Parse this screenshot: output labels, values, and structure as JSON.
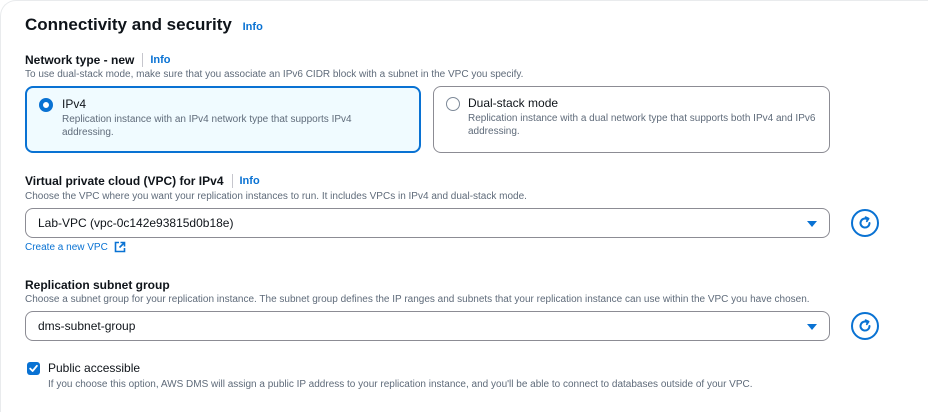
{
  "section": {
    "title": "Connectivity and security",
    "info": "Info"
  },
  "network_type": {
    "label": "Network type - new",
    "info": "Info",
    "description": "To use dual-stack mode, make sure that you associate an IPv6 CIDR block with a subnet in the VPC you specify.",
    "options": [
      {
        "title": "IPv4",
        "description": "Replication instance with an IPv4 network type that supports IPv4 addressing.",
        "selected": true
      },
      {
        "title": "Dual-stack mode",
        "description": "Replication instance with a dual network type that supports both IPv4 and IPv6 addressing.",
        "selected": false
      }
    ]
  },
  "vpc": {
    "label": "Virtual private cloud (VPC) for IPv4",
    "info": "Info",
    "description": "Choose the VPC where you want your replication instances to run. It includes VPCs in IPv4 and dual-stack mode.",
    "selected_value": "Lab-VPC (vpc-0c142e93815d0b18e)",
    "create_link": "Create a new VPC"
  },
  "subnet_group": {
    "label": "Replication subnet group",
    "description": "Choose a subnet group for your replication instance. The subnet group defines the IP ranges and subnets that your replication instance can use within the VPC you have chosen.",
    "selected_value": "dms-subnet-group"
  },
  "public_accessible": {
    "label": "Public accessible",
    "checked": true,
    "description": "If you choose this option, AWS DMS will assign a public IP address to your replication instance, and you'll be able to connect to databases outside of your VPC."
  },
  "colors": {
    "accent": "#0972d3",
    "selected_tile_bg": "#f0fbff",
    "text_secondary": "#5f6b7a"
  }
}
